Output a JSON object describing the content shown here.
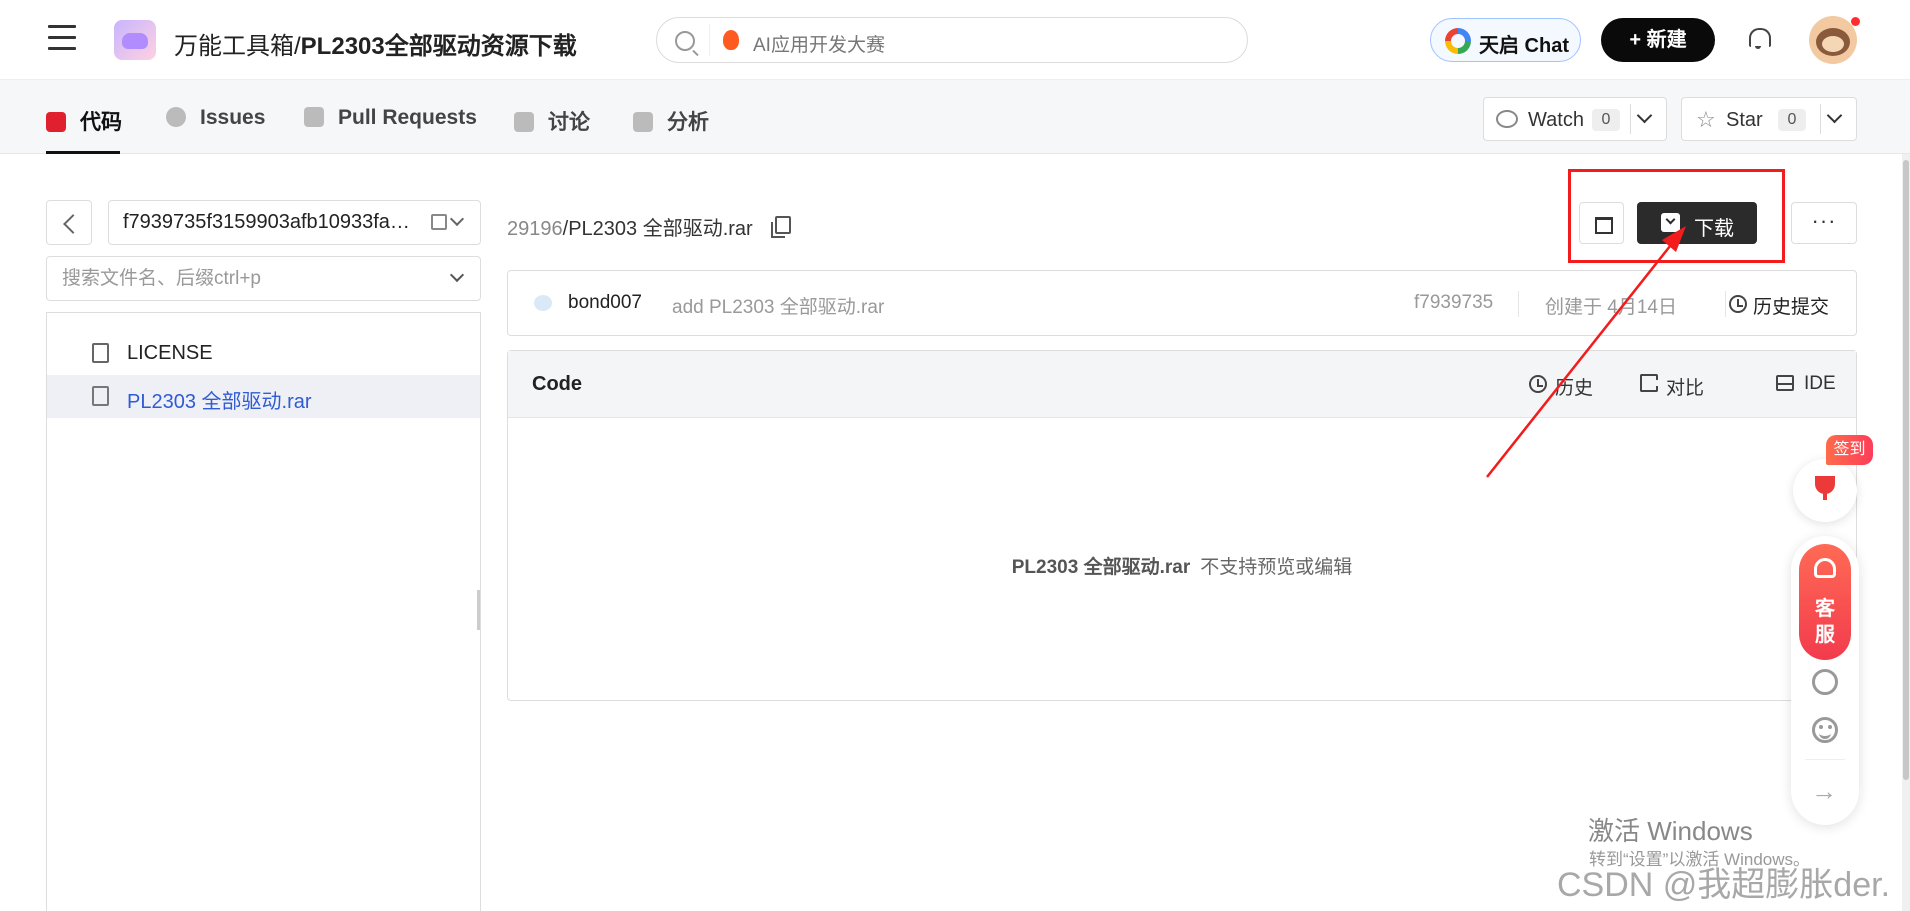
{
  "header": {
    "repo_owner": "万能工具箱/",
    "repo_name": "PL2303全部驱动资源下载",
    "search_hint": "AI应用开发大赛",
    "tianqi_chat_label": "天启 Chat",
    "new_button_label": "+ 新建"
  },
  "tabs": [
    {
      "label": "代码",
      "icon": "code-icon",
      "active": true
    },
    {
      "label": "Issues",
      "icon": "issue-icon"
    },
    {
      "label": "Pull Requests",
      "icon": "pull-request-icon"
    },
    {
      "label": "讨论",
      "icon": "discussion-icon"
    },
    {
      "label": "分析",
      "icon": "chart-icon"
    }
  ],
  "watch": {
    "label": "Watch",
    "count": "0"
  },
  "star": {
    "label": "Star",
    "count": "0"
  },
  "sidebar": {
    "branch": "f7939735f3159903afb10933fa…",
    "file_search_placeholder": "搜索文件名、后缀ctrl+p",
    "files": [
      {
        "name": "LICENSE",
        "selected": false
      },
      {
        "name": "PL2303 全部驱动.rar",
        "selected": true
      }
    ]
  },
  "breadcrumb": {
    "root": "29196",
    "sep": "/",
    "file": "PL2303 全部驱动.rar"
  },
  "actions": {
    "download_label": "下载",
    "more_label": "···"
  },
  "commit": {
    "user": "bond007",
    "message": "add PL2303 全部驱动.rar",
    "hash": "f7939735",
    "date": "创建于 4月14日",
    "history_label": "历史提交"
  },
  "code_panel": {
    "title": "Code",
    "history_label": "历史",
    "compare_label": "对比",
    "ide_label": "IDE",
    "empty_file": "PL2303 全部驱动.rar",
    "empty_message": "不支持预览或编辑"
  },
  "floating": {
    "sign_label": "签到",
    "service_line1": "客",
    "service_line2": "服"
  },
  "watermarks": {
    "windows_title": "激活 Windows",
    "windows_sub": "转到“设置”以激活 Windows。",
    "csdn": "CSDN @我超膨胀der."
  },
  "colors": {
    "accent_red": "#e0202f",
    "annotation_red": "#f21c1c",
    "download_bg": "#2b2b2b",
    "link_blue": "#2f5bd3"
  }
}
